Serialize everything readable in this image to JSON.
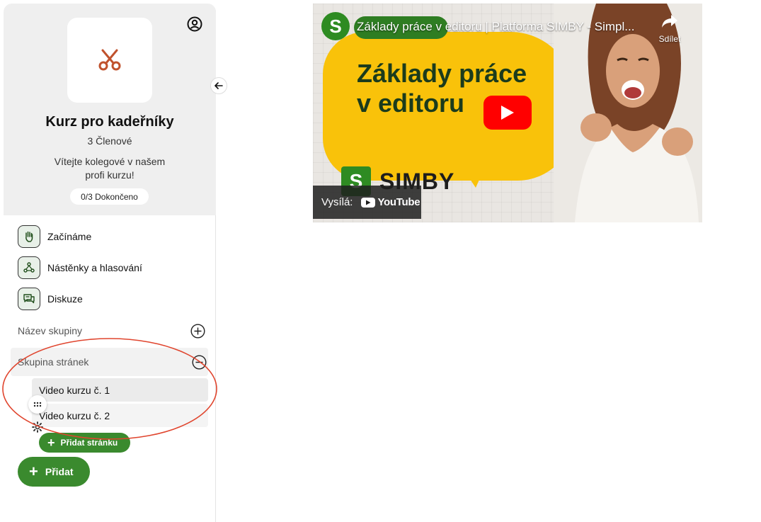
{
  "course": {
    "title": "Kurz pro kadeřníky",
    "members": "3 Členové",
    "welcome": "Vítejte kolegové v našem profi kurzu!",
    "progress": "0/3 Dokončeno"
  },
  "menu": [
    {
      "label": "Začínáme",
      "icon": "hand-icon"
    },
    {
      "label": "Nástěnky a hlasování",
      "icon": "people-network-icon"
    },
    {
      "label": "Diskuze",
      "icon": "chat-bubbles-icon"
    }
  ],
  "groups": {
    "group_name": "Název skupiny",
    "page_group": "Skupina stránek"
  },
  "pages": [
    {
      "label": "Video kurzu č. 1"
    },
    {
      "label": "Video kurzu č. 2"
    }
  ],
  "buttons": {
    "add_page": "Přidat stránku",
    "add": "Přidat"
  },
  "video": {
    "title": "Základy práce v editoru | Platforma SIMBY - Simpl...",
    "share_label": "Sdílet",
    "thumbnail_heading_line1": "Základy práce",
    "thumbnail_heading_line2": "v editoru",
    "brand": "SIMBY",
    "watch_on": "Vysílá:",
    "youtube_label": "YouTube",
    "channel_initial": "S"
  },
  "colors": {
    "brand_green": "#3a8a2e",
    "annotation_red": "#e0452e",
    "thumbnail_yellow": "#f9c20a"
  }
}
